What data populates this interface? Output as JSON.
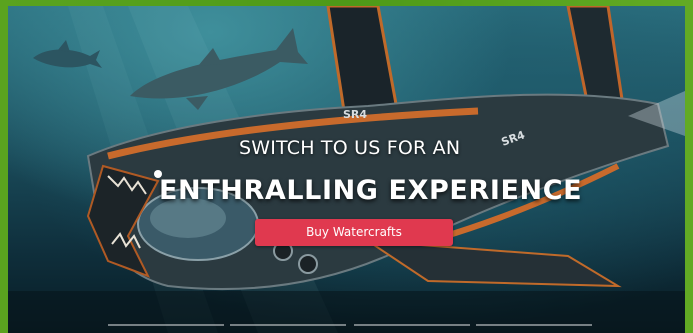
{
  "hero": {
    "subhead": "SWITCH TO US FOR AN",
    "headline": "ENTHRALLING EXPERIENCE",
    "cta_label": "Buy Watercrafts",
    "craft_marking": "SR4",
    "slide_count": 4,
    "active_slide": 1
  },
  "colors": {
    "frame": "#4f9a1c",
    "cta": "#e0394f",
    "water_dark": "#0f2f3c"
  }
}
